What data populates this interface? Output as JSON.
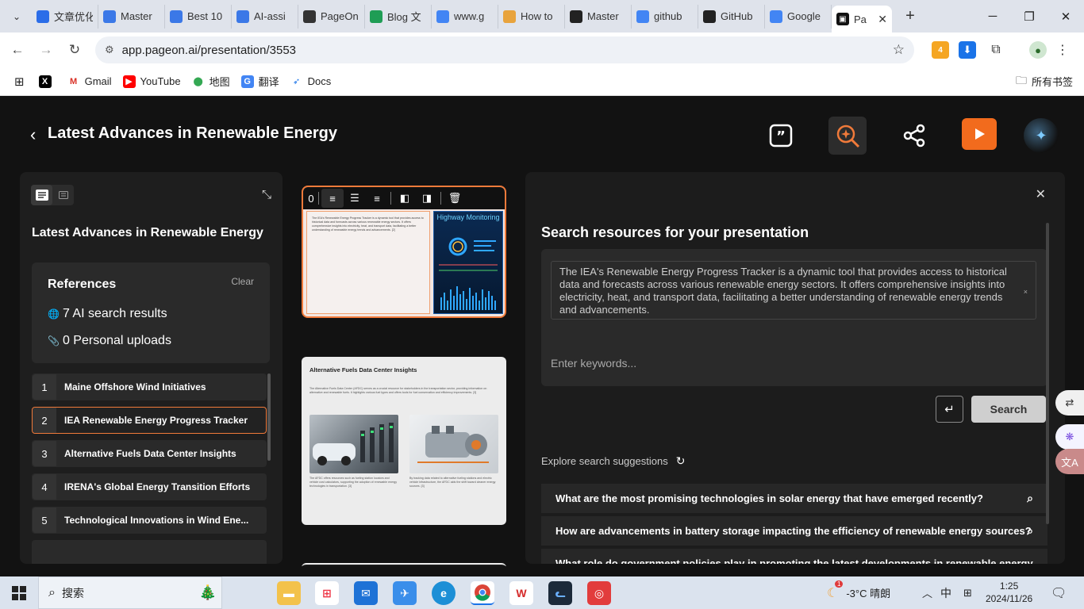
{
  "browser": {
    "tabs": [
      {
        "label": "文章优化",
        "icon": "doc-check-icon",
        "color": "#2b6de8"
      },
      {
        "label": "Master",
        "icon": "docs-icon",
        "color": "#3b78e7"
      },
      {
        "label": "Best 10",
        "icon": "docs-icon",
        "color": "#3b78e7"
      },
      {
        "label": "AI-assi",
        "icon": "docs-icon",
        "color": "#3b78e7"
      },
      {
        "label": "PageOn",
        "icon": "openai-icon",
        "color": "#333333"
      },
      {
        "label": "Blog 文",
        "icon": "sheets-icon",
        "color": "#1f9d55"
      },
      {
        "label": "www.g",
        "icon": "google-icon",
        "color": "#4285f4"
      },
      {
        "label": "How to",
        "icon": "folder-icon",
        "color": "#e8a33c"
      },
      {
        "label": "Master",
        "icon": "pageon-icon",
        "color": "#222222"
      },
      {
        "label": "github",
        "icon": "google-icon",
        "color": "#4285f4"
      },
      {
        "label": "GitHub",
        "icon": "github-icon",
        "color": "#222222"
      },
      {
        "label": "Google",
        "icon": "translate-icon",
        "color": "#4285f4"
      }
    ],
    "active_tab": {
      "label": "Pa",
      "close": "✕"
    },
    "new_tab": "+",
    "url": "app.pageon.ai/presentation/3553",
    "ext_badge": "4",
    "bookmarks": [
      {
        "label": "",
        "icon": "x-icon"
      },
      {
        "label": "Gmail",
        "icon": "gmail-icon"
      },
      {
        "label": "YouTube",
        "icon": "youtube-icon"
      },
      {
        "label": "地图",
        "icon": "maps-icon"
      },
      {
        "label": "翻译",
        "icon": "translate-icon"
      },
      {
        "label": "Docs",
        "icon": "docs-bird-icon"
      }
    ],
    "bookmarks_right": "所有书签"
  },
  "app": {
    "title": "Latest Advances in Renewable Energy",
    "left": {
      "title": "Latest Advances in Renewable Energy",
      "references_title": "References",
      "clear_label": "Clear",
      "ai_results": "7 AI search results",
      "personal_uploads": "0 Personal uploads",
      "items": [
        {
          "num": "1",
          "label": "Maine Offshore Wind Initiatives"
        },
        {
          "num": "2",
          "label": "IEA Renewable Energy Progress Tracker"
        },
        {
          "num": "3",
          "label": "Alternative Fuels Data Center Insights"
        },
        {
          "num": "4",
          "label": "IRENA's Global Energy Transition Efforts"
        },
        {
          "num": "5",
          "label": "Technological Innovations in Wind Ene..."
        }
      ]
    },
    "slides": {
      "slide1_text": "The IEA's Renewable Energy Progress Tracker is a dynamic tool that provides access to historical data and forecasts across various renewable energy sectors. It offers comprehensive insights into electricity, heat, and transport data, facilitating a better understanding of renewable energy trends and advancements. [2]",
      "slide1_image_title": "Highway Monitoring",
      "slide2_title": "Alternative Fuels Data Center Insights",
      "slide2_text": "The Alternative Fuels Data Center (AFDC) serves as a crucial resource for stakeholders in the transportation sector, providing information on alternative and renewable fuels. It highlights various fuel types and offers tools for fuel conservation and efficiency improvements. [3]",
      "slide2_cap1": "The AFDC offers resources such as fueling station locators and vehicle cost calculators, supporting the adoption of renewable energy technologies in transportation. [3]",
      "slide2_cap2": "By tracking data related to alternative fueling stations and electric vehicle infrastructure, the AFDC aids the shift toward cleaner energy sources. [3]"
    },
    "right": {
      "title": "Search resources for your presentation",
      "chip_text": "The IEA's Renewable Energy Progress Tracker is a dynamic tool that provides access to historical data and forecasts across various renewable energy sectors. It offers comprehensive insights into electricity, heat, and transport data, facilitating a better understanding of renewable energy trends and advancements.",
      "chip_close": "×",
      "keywords_placeholder": "Enter keywords...",
      "enter_label": "↵",
      "search_label": "Search",
      "explore_label": "Explore search suggestions",
      "suggestions": [
        "What are the most promising technologies in solar energy that have emerged recently?",
        "How are advancements in battery storage impacting the efficiency of renewable energy sources?",
        "What role do government policies play in promoting the latest developments in renewable energy"
      ]
    }
  },
  "taskbar": {
    "search_label": "搜索",
    "weather": "-3°C 晴朗",
    "weather_badge": "1",
    "ime": "中",
    "time": "1:25",
    "date": "2024/11/26"
  },
  "colors": {
    "accent": "#f07a3a",
    "play": "#f26b1d",
    "app_bg": "#121212",
    "panel_bg": "#1e1e1e"
  }
}
